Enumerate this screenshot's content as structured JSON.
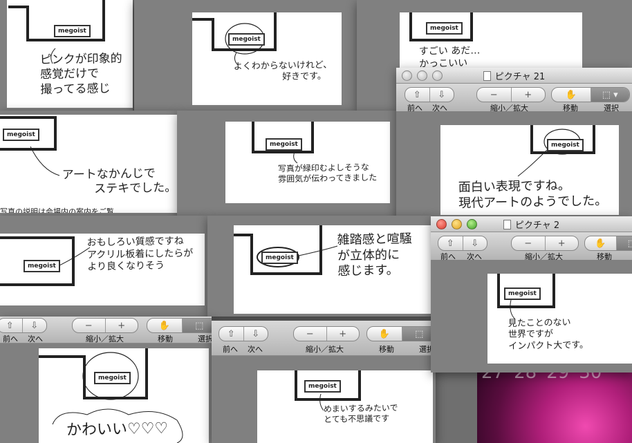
{
  "desktop": {
    "calendar_numbers": [
      "27",
      "28",
      "29",
      "30"
    ]
  },
  "toolbar_labels": {
    "prev": "前へ",
    "next": "次へ",
    "zoom": "縮小／拡大",
    "move": "移動",
    "select": "選択"
  },
  "windows": [
    {
      "id": "w1",
      "title": "",
      "note": [
        "ピンクが印象的",
        "感覚だけで",
        "撮ってる感じ"
      ]
    },
    {
      "id": "w2",
      "title": "",
      "note": [
        "よくわからないけれど、",
        "好きです。"
      ]
    },
    {
      "id": "w3",
      "title": "",
      "note": [
        "すごい あだ…",
        "かっこいい"
      ]
    },
    {
      "id": "w4",
      "title": "ピクチャ 21",
      "note": [
        "面白い表現ですね。",
        "現代アートのようでした。"
      ]
    },
    {
      "id": "w5",
      "title": "",
      "note": [
        "アートなかんじで",
        "ステキでした。"
      ],
      "caption": "写真の説明は会場内の案内をご覧"
    },
    {
      "id": "w6",
      "title": "",
      "note": [
        "写真が緑印むよしそうな",
        "雰囲気が伝わってきました"
      ]
    },
    {
      "id": "w7",
      "title": "",
      "note": [
        "おもしろい質感ですね",
        "アクリル板着にしたらが",
        "より良くなりそう"
      ]
    },
    {
      "id": "w8",
      "title": "",
      "note": [
        "雑踏感と喧騒",
        "が立体的に",
        "感じます。"
      ]
    },
    {
      "id": "w9",
      "title": "ピクチャ 2",
      "note": [
        "見たことのない",
        "世界ですが",
        "インパクト大です。"
      ]
    },
    {
      "id": "w10",
      "title": "",
      "note": [
        "かわいい♡♡♡"
      ]
    },
    {
      "id": "w11",
      "title": "",
      "note": [
        "めまいするみたいで",
        "とても不思議です"
      ]
    }
  ],
  "logo_text": "megoist"
}
